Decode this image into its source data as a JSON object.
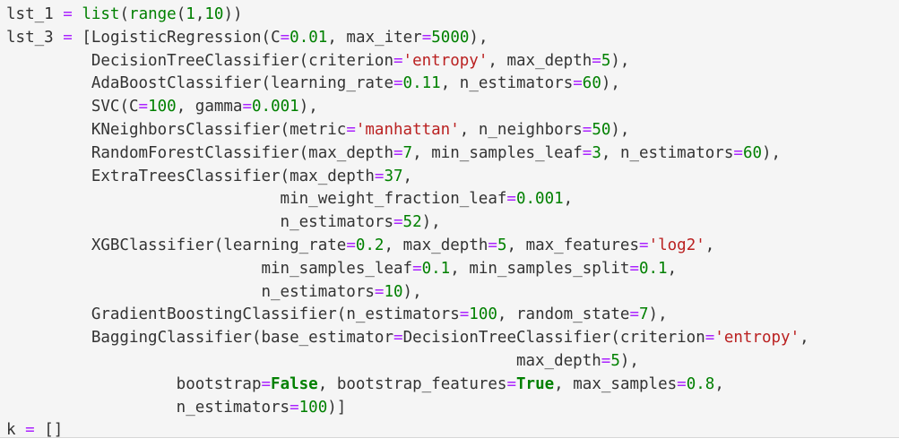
{
  "colors": {
    "background": "#f5f5f5",
    "text": "#333333",
    "operator": "#aa22ff",
    "number": "#008000",
    "string": "#ba2121",
    "keyword": "#008000"
  },
  "code": {
    "lines": [
      [
        [
          "name",
          "lst_1"
        ],
        [
          "ws",
          " "
        ],
        [
          "op",
          "="
        ],
        [
          "ws",
          " "
        ],
        [
          "builtin",
          "list"
        ],
        [
          "punc",
          "("
        ],
        [
          "builtin",
          "range"
        ],
        [
          "punc",
          "("
        ],
        [
          "num",
          "1"
        ],
        [
          "punc",
          ","
        ],
        [
          "num",
          "10"
        ],
        [
          "punc",
          "))"
        ]
      ],
      [
        [
          "name",
          "lst_3"
        ],
        [
          "ws",
          " "
        ],
        [
          "op",
          "="
        ],
        [
          "ws",
          " "
        ],
        [
          "punc",
          "["
        ],
        [
          "name",
          "LogisticRegression"
        ],
        [
          "punc",
          "("
        ],
        [
          "name",
          "C"
        ],
        [
          "op",
          "="
        ],
        [
          "num",
          "0.01"
        ],
        [
          "punc",
          ","
        ],
        [
          "ws",
          " "
        ],
        [
          "name",
          "max_iter"
        ],
        [
          "op",
          "="
        ],
        [
          "num",
          "5000"
        ],
        [
          "punc",
          "),"
        ]
      ],
      [
        [
          "ws",
          "         "
        ],
        [
          "name",
          "DecisionTreeClassifier"
        ],
        [
          "punc",
          "("
        ],
        [
          "name",
          "criterion"
        ],
        [
          "op",
          "="
        ],
        [
          "str",
          "'entropy'"
        ],
        [
          "punc",
          ","
        ],
        [
          "ws",
          " "
        ],
        [
          "name",
          "max_depth"
        ],
        [
          "op",
          "="
        ],
        [
          "num",
          "5"
        ],
        [
          "punc",
          "),"
        ]
      ],
      [
        [
          "ws",
          "         "
        ],
        [
          "name",
          "AdaBoostClassifier"
        ],
        [
          "punc",
          "("
        ],
        [
          "name",
          "learning_rate"
        ],
        [
          "op",
          "="
        ],
        [
          "num",
          "0.11"
        ],
        [
          "punc",
          ","
        ],
        [
          "ws",
          " "
        ],
        [
          "name",
          "n_estimators"
        ],
        [
          "op",
          "="
        ],
        [
          "num",
          "60"
        ],
        [
          "punc",
          "),"
        ]
      ],
      [
        [
          "ws",
          "         "
        ],
        [
          "name",
          "SVC"
        ],
        [
          "punc",
          "("
        ],
        [
          "name",
          "C"
        ],
        [
          "op",
          "="
        ],
        [
          "num",
          "100"
        ],
        [
          "punc",
          ","
        ],
        [
          "ws",
          " "
        ],
        [
          "name",
          "gamma"
        ],
        [
          "op",
          "="
        ],
        [
          "num",
          "0.001"
        ],
        [
          "punc",
          "),"
        ]
      ],
      [
        [
          "ws",
          "         "
        ],
        [
          "name",
          "KNeighborsClassifier"
        ],
        [
          "punc",
          "("
        ],
        [
          "name",
          "metric"
        ],
        [
          "op",
          "="
        ],
        [
          "str",
          "'manhattan'"
        ],
        [
          "punc",
          ","
        ],
        [
          "ws",
          " "
        ],
        [
          "name",
          "n_neighbors"
        ],
        [
          "op",
          "="
        ],
        [
          "num",
          "50"
        ],
        [
          "punc",
          "),"
        ]
      ],
      [
        [
          "ws",
          "         "
        ],
        [
          "name",
          "RandomForestClassifier"
        ],
        [
          "punc",
          "("
        ],
        [
          "name",
          "max_depth"
        ],
        [
          "op",
          "="
        ],
        [
          "num",
          "7"
        ],
        [
          "punc",
          ","
        ],
        [
          "ws",
          " "
        ],
        [
          "name",
          "min_samples_leaf"
        ],
        [
          "op",
          "="
        ],
        [
          "num",
          "3"
        ],
        [
          "punc",
          ","
        ],
        [
          "ws",
          " "
        ],
        [
          "name",
          "n_estimators"
        ],
        [
          "op",
          "="
        ],
        [
          "num",
          "60"
        ],
        [
          "punc",
          "),"
        ]
      ],
      [
        [
          "ws",
          "         "
        ],
        [
          "name",
          "ExtraTreesClassifier"
        ],
        [
          "punc",
          "("
        ],
        [
          "name",
          "max_depth"
        ],
        [
          "op",
          "="
        ],
        [
          "num",
          "37"
        ],
        [
          "punc",
          ","
        ]
      ],
      [
        [
          "ws",
          "                             "
        ],
        [
          "name",
          "min_weight_fraction_leaf"
        ],
        [
          "op",
          "="
        ],
        [
          "num",
          "0.001"
        ],
        [
          "punc",
          ","
        ]
      ],
      [
        [
          "ws",
          "                             "
        ],
        [
          "name",
          "n_estimators"
        ],
        [
          "op",
          "="
        ],
        [
          "num",
          "52"
        ],
        [
          "punc",
          "),"
        ]
      ],
      [
        [
          "ws",
          "         "
        ],
        [
          "name",
          "XGBClassifier"
        ],
        [
          "punc",
          "("
        ],
        [
          "name",
          "learning_rate"
        ],
        [
          "op",
          "="
        ],
        [
          "num",
          "0.2"
        ],
        [
          "punc",
          ","
        ],
        [
          "ws",
          " "
        ],
        [
          "name",
          "max_depth"
        ],
        [
          "op",
          "="
        ],
        [
          "num",
          "5"
        ],
        [
          "punc",
          ","
        ],
        [
          "ws",
          " "
        ],
        [
          "name",
          "max_features"
        ],
        [
          "op",
          "="
        ],
        [
          "str",
          "'log2'"
        ],
        [
          "punc",
          ","
        ]
      ],
      [
        [
          "ws",
          "                           "
        ],
        [
          "name",
          "min_samples_leaf"
        ],
        [
          "op",
          "="
        ],
        [
          "num",
          "0.1"
        ],
        [
          "punc",
          ","
        ],
        [
          "ws",
          " "
        ],
        [
          "name",
          "min_samples_split"
        ],
        [
          "op",
          "="
        ],
        [
          "num",
          "0.1"
        ],
        [
          "punc",
          ","
        ]
      ],
      [
        [
          "ws",
          "                           "
        ],
        [
          "name",
          "n_estimators"
        ],
        [
          "op",
          "="
        ],
        [
          "num",
          "10"
        ],
        [
          "punc",
          "),"
        ]
      ],
      [
        [
          "ws",
          "         "
        ],
        [
          "name",
          "GradientBoostingClassifier"
        ],
        [
          "punc",
          "("
        ],
        [
          "name",
          "n_estimators"
        ],
        [
          "op",
          "="
        ],
        [
          "num",
          "100"
        ],
        [
          "punc",
          ","
        ],
        [
          "ws",
          " "
        ],
        [
          "name",
          "random_state"
        ],
        [
          "op",
          "="
        ],
        [
          "num",
          "7"
        ],
        [
          "punc",
          "),"
        ]
      ],
      [
        [
          "ws",
          "         "
        ],
        [
          "name",
          "BaggingClassifier"
        ],
        [
          "punc",
          "("
        ],
        [
          "name",
          "base_estimator"
        ],
        [
          "op",
          "="
        ],
        [
          "name",
          "DecisionTreeClassifier"
        ],
        [
          "punc",
          "("
        ],
        [
          "name",
          "criterion"
        ],
        [
          "op",
          "="
        ],
        [
          "str",
          "'entropy'"
        ],
        [
          "punc",
          ","
        ]
      ],
      [
        [
          "ws",
          "                                                      "
        ],
        [
          "name",
          "max_depth"
        ],
        [
          "op",
          "="
        ],
        [
          "num",
          "5"
        ],
        [
          "punc",
          "),"
        ]
      ],
      [
        [
          "ws",
          "                  "
        ],
        [
          "name",
          "bootstrap"
        ],
        [
          "op",
          "="
        ],
        [
          "kw",
          "False"
        ],
        [
          "punc",
          ","
        ],
        [
          "ws",
          " "
        ],
        [
          "name",
          "bootstrap_features"
        ],
        [
          "op",
          "="
        ],
        [
          "kw",
          "True"
        ],
        [
          "punc",
          ","
        ],
        [
          "ws",
          " "
        ],
        [
          "name",
          "max_samples"
        ],
        [
          "op",
          "="
        ],
        [
          "num",
          "0.8"
        ],
        [
          "punc",
          ","
        ]
      ],
      [
        [
          "ws",
          "                  "
        ],
        [
          "name",
          "n_estimators"
        ],
        [
          "op",
          "="
        ],
        [
          "num",
          "100"
        ],
        [
          "punc",
          ")]"
        ]
      ],
      [
        [
          "name",
          "k"
        ],
        [
          "ws",
          " "
        ],
        [
          "op",
          "="
        ],
        [
          "ws",
          " "
        ],
        [
          "punc",
          "[]"
        ]
      ]
    ]
  }
}
